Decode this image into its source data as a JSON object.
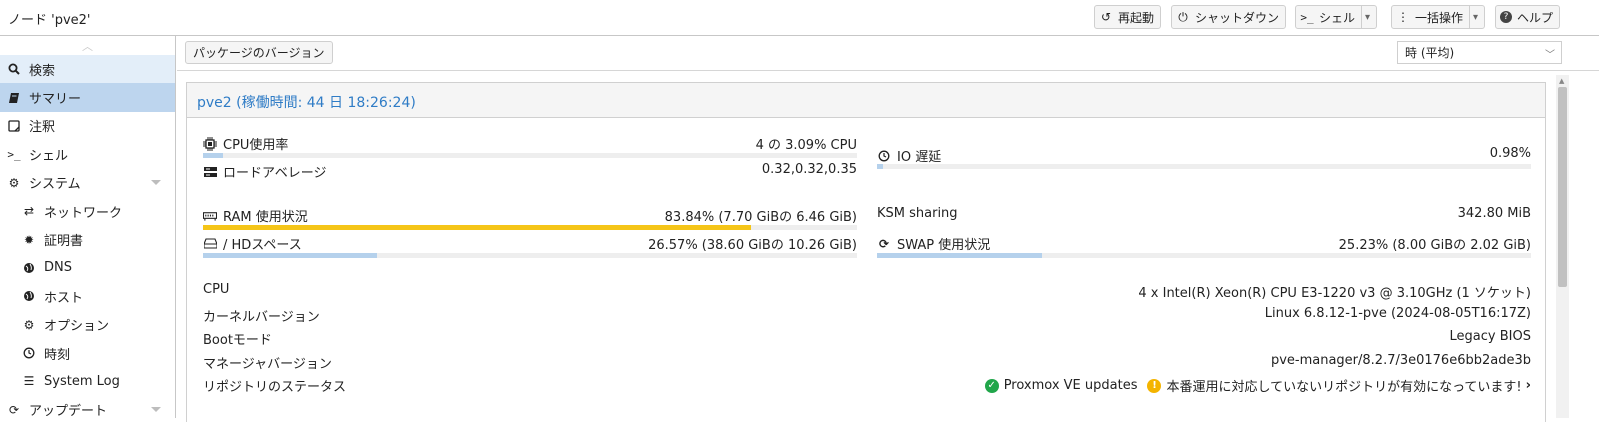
{
  "header": {
    "title": "ノード 'pve2'",
    "buttons": {
      "reboot": "再起動",
      "shutdown": "シャットダウン",
      "shell": "シェル",
      "bulk": "一括操作",
      "help": "ヘルプ"
    }
  },
  "sidebar": {
    "items": [
      {
        "label": "検索",
        "icon": "search-icon"
      },
      {
        "label": "サマリー",
        "icon": "book-icon"
      },
      {
        "label": "注釈",
        "icon": "note-icon"
      },
      {
        "label": "シェル",
        "icon": "terminal-icon"
      },
      {
        "label": "システム",
        "icon": "cogs-icon"
      },
      {
        "label": "ネットワーク",
        "icon": "exchange-icon"
      },
      {
        "label": "証明書",
        "icon": "certificate-icon"
      },
      {
        "label": "DNS",
        "icon": "globe-icon"
      },
      {
        "label": "ホスト",
        "icon": "globe-icon"
      },
      {
        "label": "オプション",
        "icon": "gear-icon"
      },
      {
        "label": "時刻",
        "icon": "clock-icon"
      },
      {
        "label": "System Log",
        "icon": "list-icon"
      },
      {
        "label": "アップデート",
        "icon": "refresh-icon"
      }
    ]
  },
  "toolbar": {
    "package_versions": "パッケージのバージョン",
    "timeframe": "時 (平均)"
  },
  "summary": {
    "title": "pve2 (稼働時間: 44 日 18:26:24)",
    "cpu": {
      "label": "CPU使用率",
      "value": "4 の 3.09% CPU",
      "percent": 3.09
    },
    "load": {
      "label": "ロードアベレージ",
      "value": "0.32,0.32,0.35"
    },
    "io": {
      "label": "IO 遅延",
      "value": "0.98%",
      "percent": 0.98
    },
    "ram": {
      "label": "RAM 使用状況",
      "value": "83.84% (7.70 GiBの 6.46 GiB)",
      "percent": 83.84
    },
    "ksm": {
      "label": "KSM sharing",
      "value": "342.80 MiB"
    },
    "hd": {
      "label": "/ HDスペース",
      "value": "26.57% (38.60 GiBの 10.26 GiB)",
      "percent": 26.57
    },
    "swap": {
      "label": "SWAP 使用状況",
      "value": "25.23% (8.00 GiBの 2.02 GiB)",
      "percent": 25.23
    },
    "info": {
      "cpu_label": "CPU",
      "cpu_value": "4 x Intel(R) Xeon(R) CPU E3-1220 v3 @ 3.10GHz (1 ソケット)",
      "kernel_label": "カーネルバージョン",
      "kernel_value": "Linux 6.8.12-1-pve (2024-08-05T16:17Z)",
      "boot_label": "Bootモード",
      "boot_value": "Legacy BIOS",
      "manager_label": "マネージャバージョン",
      "manager_value": "pve-manager/8.2.7/3e0176e6bb2ade3b",
      "repo_label": "リポジトリのステータス",
      "repo_ok": "Proxmox VE updates",
      "repo_warn": "本番運用に対応していないリポジトリが有効になっています!"
    }
  },
  "colors": {
    "accent": "#2f7cc6",
    "selected": "#bdd5ee",
    "bar": "#b5d1ec",
    "warn_bar": "#f5c518",
    "ok": "#21a64a",
    "warn": "#f4b400"
  }
}
